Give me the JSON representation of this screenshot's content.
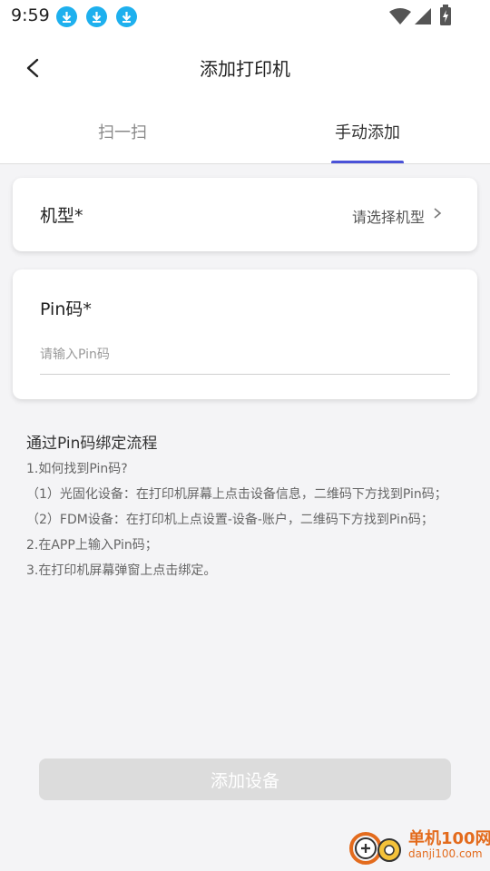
{
  "status_bar": {
    "time": "9:59"
  },
  "header": {
    "title": "添加打印机"
  },
  "tabs": [
    {
      "label": "扫一扫"
    },
    {
      "label": "手动添加"
    }
  ],
  "model_card": {
    "label": "机型*",
    "select_placeholder": "请选择机型"
  },
  "pin_card": {
    "label": "Pin码*",
    "placeholder": "请输入Pin码",
    "value": ""
  },
  "instructions": {
    "title": "通过Pin码绑定流程",
    "lines": [
      "1.如何找到Pin码?",
      "（1）光固化设备：在打印机屏幕上点击设备信息，二维码下方找到Pin码；",
      "（2）FDM设备：在打印机上点设置-设备-账户，二维码下方找到Pin码；",
      "2.在APP上输入Pin码；",
      "3.在打印机屏幕弹窗上点击绑定。"
    ]
  },
  "add_button": {
    "label": "添加设备"
  },
  "watermark": {
    "site": "单机100网",
    "domain": "danji100.com"
  },
  "colors": {
    "accent": "#4a52d8",
    "download_icon": "#1eb0ee",
    "button_disabled": "#dcdcdc"
  }
}
